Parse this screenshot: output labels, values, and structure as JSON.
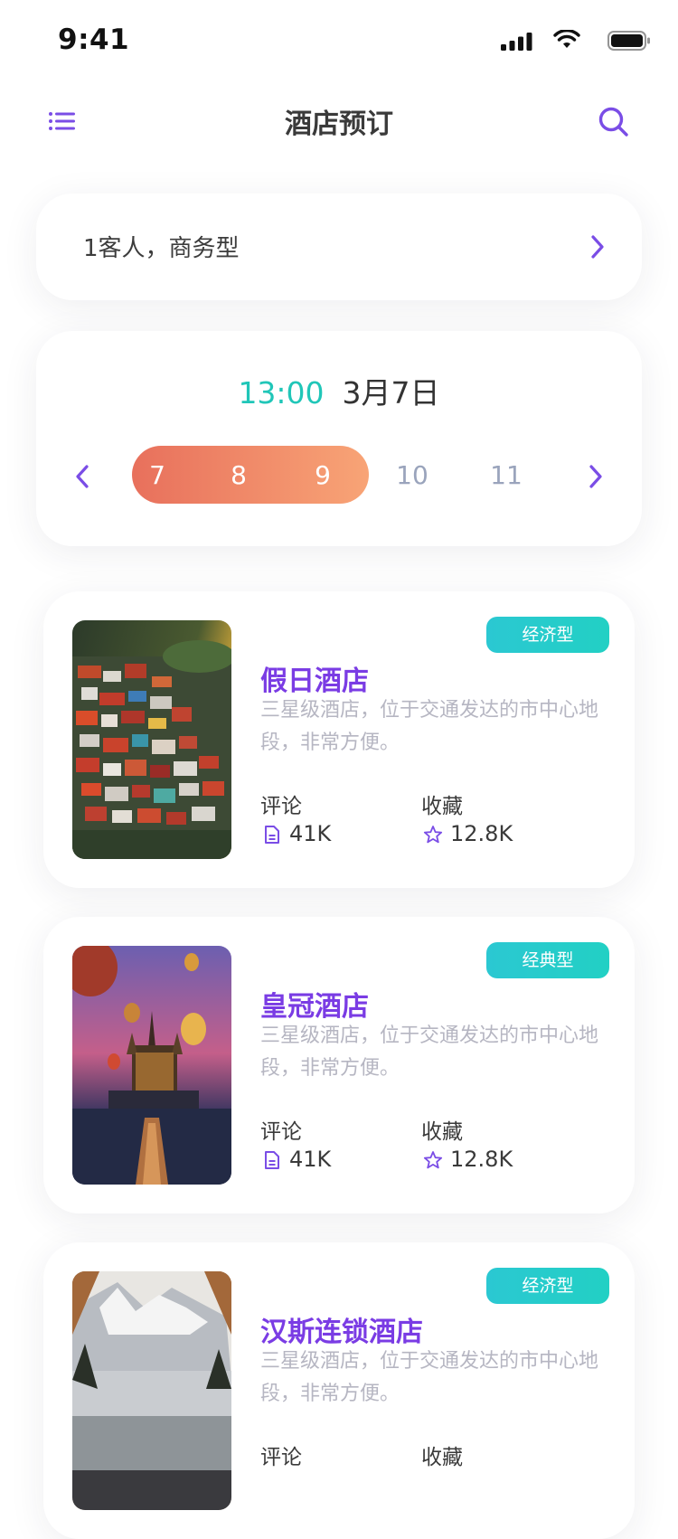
{
  "status_bar": {
    "time": "9:41"
  },
  "nav": {
    "title": "酒店预订",
    "menu_icon": "menu-icon",
    "search_icon": "search-icon"
  },
  "guest": {
    "text": "1客人，商务型"
  },
  "date": {
    "time": "13:00",
    "date": "3月7日",
    "days": [
      "7",
      "8",
      "9",
      "10",
      "11"
    ],
    "selected_range": [
      "7",
      "9"
    ]
  },
  "colors": {
    "accent": "#7a3ce4",
    "teal": "#20c6b8",
    "orange_start": "#e8705c",
    "orange_end": "#f8a476"
  },
  "hotels": [
    {
      "name": "假日酒店",
      "badge": "经济型",
      "description": "三星级酒店，位于交通发达的市中心地段，非常方便。",
      "comments_label": "评论",
      "comments": "41K",
      "favorites_label": "收藏",
      "favorites": "12.8K",
      "photo": "hillside-town-photo"
    },
    {
      "name": "皇冠酒店",
      "badge": "经典型",
      "description": "三星级酒店，位于交通发达的市中心地段，非常方便。",
      "comments_label": "评论",
      "comments": "41K",
      "favorites_label": "收藏",
      "favorites": "12.8K",
      "photo": "castle-balloons-photo"
    },
    {
      "name": "汉斯连锁酒店",
      "badge": "经济型",
      "description": "三星级酒店，位于交通发达的市中心地段，非常方便。",
      "comments_label": "评论",
      "favorites_label": "收藏",
      "photo": "mountain-lake-tent-photo"
    }
  ]
}
